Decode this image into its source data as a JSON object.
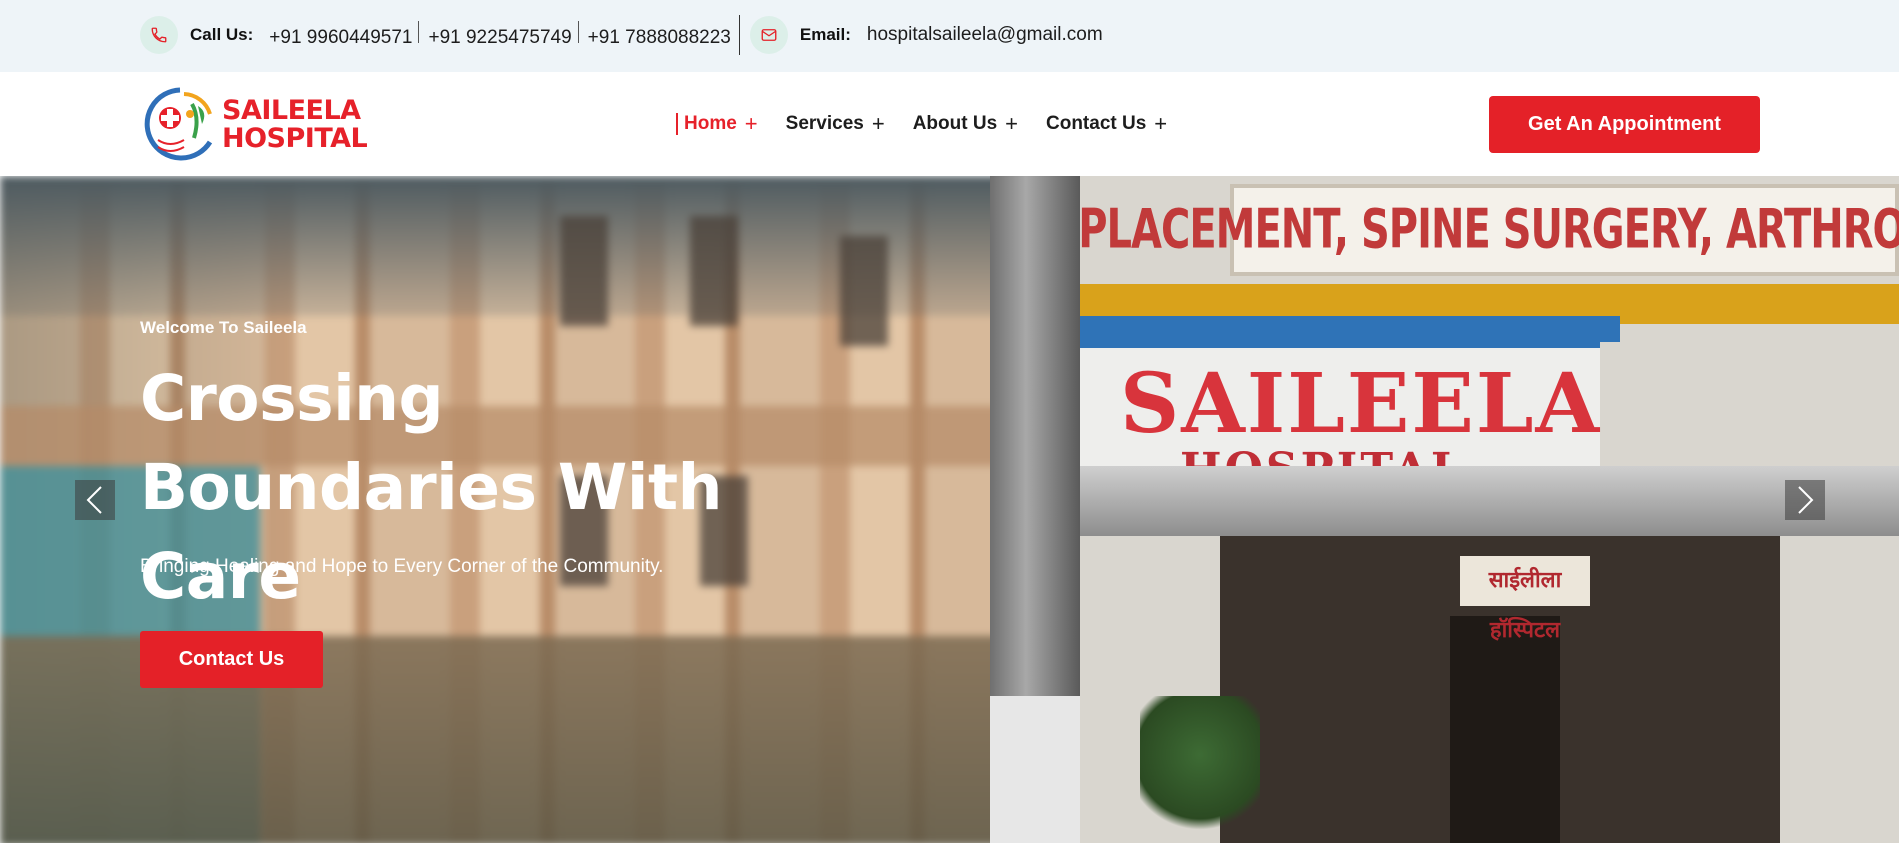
{
  "topbar": {
    "call_label": "Call Us:",
    "phones": [
      "+91 9960449571",
      "+91 9225475749",
      "+91 7888088223"
    ],
    "email_label": "Email:",
    "email": "hospitalsaileela@gmail.com",
    "icons": [
      "phone-icon",
      "mail-icon"
    ]
  },
  "header": {
    "logo": {
      "line1": "SAILEELA",
      "line2": "HOSPITAL"
    },
    "nav": [
      {
        "label": "Home",
        "active": true
      },
      {
        "label": "Services",
        "active": false
      },
      {
        "label": "About Us",
        "active": false
      },
      {
        "label": "Contact Us",
        "active": false
      }
    ],
    "plus_glyph": "+",
    "cta_label": "Get An Appointment"
  },
  "hero": {
    "kicker": "Welcome To Saileela",
    "title": "Crossing Boundaries With Care",
    "subtitle": "Bringing Healing and Hope to Every Corner of the Community.",
    "cta_label": "Contact Us",
    "photo": {
      "sign_top": "JOINT REPLACEMENT, SPINE SURGERY, ARTHROSCOPY, HAND S",
      "sign_main_1": "SAILEELA",
      "sign_main_2": "HOSPITAL",
      "sign_marathi": "साईलीला हॉस्पिटल"
    }
  },
  "colors": {
    "brand_red": "#e42128",
    "topbar_bg": "#eef4f8",
    "icon_bg": "#dcefe9"
  }
}
